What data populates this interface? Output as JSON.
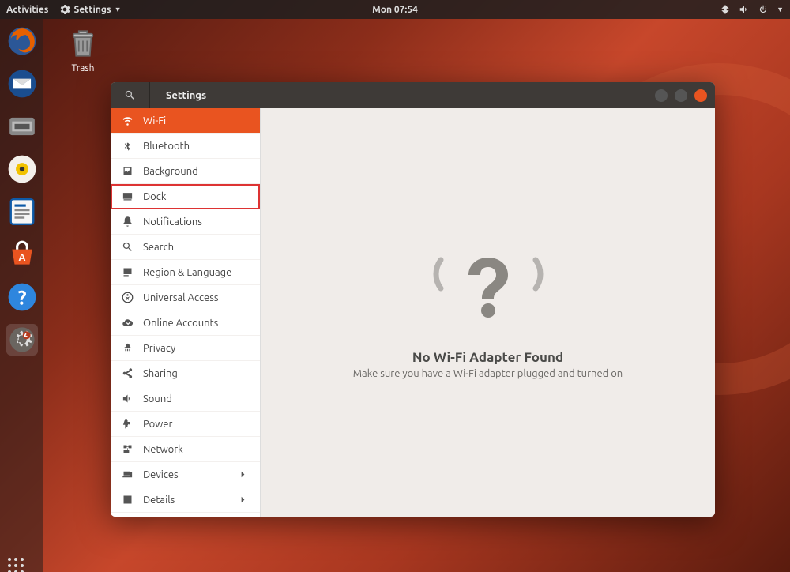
{
  "topbar": {
    "activities": "Activities",
    "app_menu": "Settings",
    "clock": "Mon 07:54"
  },
  "desktop": {
    "trash_label": "Trash"
  },
  "window": {
    "title": "Settings",
    "sidebar": [
      {
        "key": "wifi",
        "label": "Wi-Fi",
        "icon": "wifi",
        "selected": true
      },
      {
        "key": "bluetooth",
        "label": "Bluetooth",
        "icon": "bluetooth"
      },
      {
        "key": "background",
        "label": "Background",
        "icon": "background"
      },
      {
        "key": "dock",
        "label": "Dock",
        "icon": "dock",
        "highlighted": true
      },
      {
        "key": "notifications",
        "label": "Notifications",
        "icon": "bell"
      },
      {
        "key": "search",
        "label": "Search",
        "icon": "search"
      },
      {
        "key": "region",
        "label": "Region & Language",
        "icon": "region"
      },
      {
        "key": "accessibility",
        "label": "Universal Access",
        "icon": "accessibility"
      },
      {
        "key": "online-accounts",
        "label": "Online Accounts",
        "icon": "cloud"
      },
      {
        "key": "privacy",
        "label": "Privacy",
        "icon": "privacy"
      },
      {
        "key": "sharing",
        "label": "Sharing",
        "icon": "share"
      },
      {
        "key": "sound",
        "label": "Sound",
        "icon": "sound"
      },
      {
        "key": "power",
        "label": "Power",
        "icon": "power"
      },
      {
        "key": "network",
        "label": "Network",
        "icon": "network"
      },
      {
        "key": "devices",
        "label": "Devices",
        "icon": "devices",
        "has_submenu": true
      },
      {
        "key": "details",
        "label": "Details",
        "icon": "details",
        "has_submenu": true
      }
    ],
    "content": {
      "title": "No Wi-Fi Adapter Found",
      "subtitle": "Make sure you have a Wi-Fi adapter plugged and turned on"
    }
  },
  "dock_apps": [
    "firefox",
    "thunderbird",
    "files",
    "rhythmbox",
    "libreoffice-writer",
    "ubuntu-software",
    "help",
    "settings"
  ]
}
